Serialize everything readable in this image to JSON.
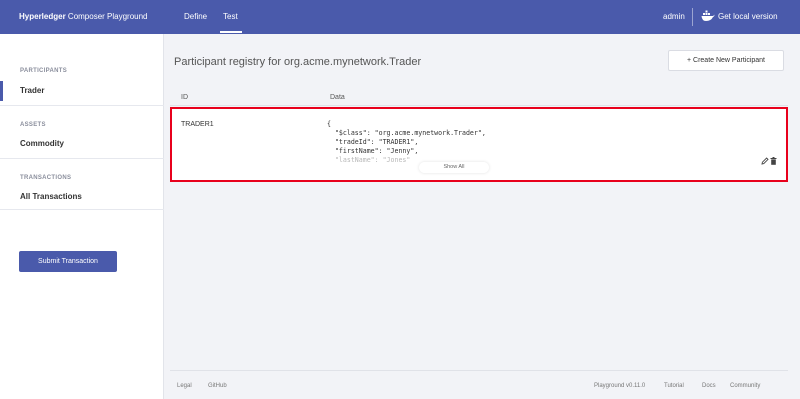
{
  "header": {
    "brand_bold": "Hyperledger",
    "brand_rest": " Composer Playground",
    "tabs": [
      {
        "label": "Define"
      },
      {
        "label": "Test"
      }
    ],
    "user": "admin",
    "get_local": "Get local version"
  },
  "sidebar": {
    "participants_heading": "PARTICIPANTS",
    "participants": [
      {
        "label": "Trader"
      }
    ],
    "assets_heading": "ASSETS",
    "assets": [
      {
        "label": "Commodity"
      }
    ],
    "transactions_heading": "TRANSACTIONS",
    "transactions": [
      {
        "label": "All Transactions"
      }
    ],
    "submit_label": "Submit Transaction"
  },
  "main": {
    "title": "Participant registry for org.acme.mynetwork.Trader",
    "create_label": "+ Create New Participant",
    "columns": {
      "id": "ID",
      "data": "Data"
    },
    "rows": [
      {
        "id": "TRADER1",
        "json_lines": [
          "{",
          "  \"$class\": \"org.acme.mynetwork.Trader\",",
          "  \"tradeId\": \"TRADER1\",",
          "  \"firstName\": \"Jenny\",",
          "  \"lastName\": \"Jones\""
        ],
        "show_all_label": "Show All"
      }
    ]
  },
  "footer": {
    "left_links": [
      "Legal",
      "GitHub"
    ],
    "version": "Playground v0.11.0",
    "right_links": [
      "Tutorial",
      "Docs",
      "Community"
    ]
  },
  "colors": {
    "header_bg": "#4a5aab",
    "accent": "#4a5aab",
    "highlight_border": "#e8001c"
  }
}
